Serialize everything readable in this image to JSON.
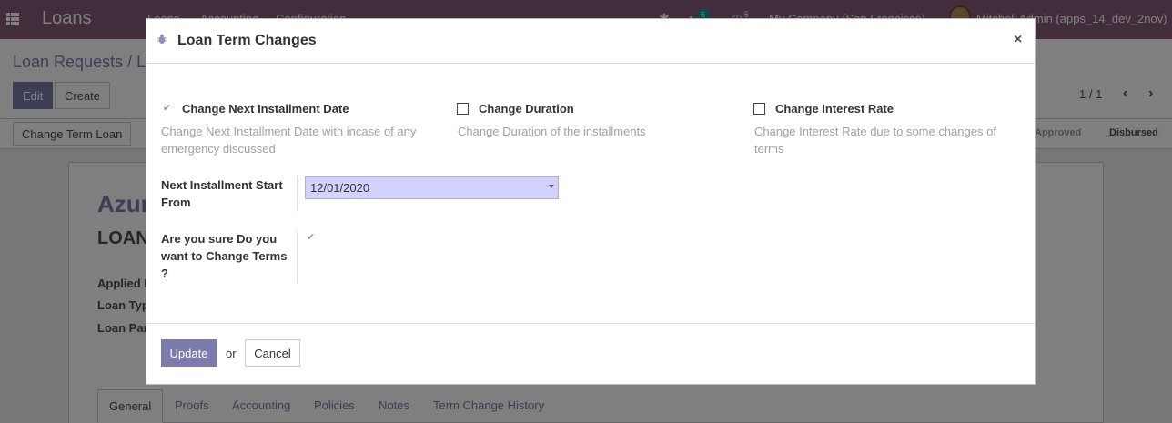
{
  "navbar": {
    "brand": "Loans",
    "menu": [
      "Loans",
      "Accounting",
      "Configuration"
    ],
    "chat_count": "6",
    "activity_count": "5",
    "company": "My Company (San Francisco)",
    "user": "Mitchell Admin (apps_14_dev_2nov)"
  },
  "control_panel": {
    "breadcrumb": "Loan Requests / L",
    "edit_label": "Edit",
    "create_label": "Create",
    "pager": "1 / 1"
  },
  "statusbar": {
    "change_term_label": "Change Term Loan",
    "stages": [
      "Approved",
      "Disbursed"
    ]
  },
  "sheet": {
    "title": "Azur",
    "subtitle": "LOAN",
    "labels": [
      "Applied I",
      "Loan Typ",
      "Loan Par"
    ]
  },
  "tabs": [
    "General",
    "Proofs",
    "Accounting",
    "Policies",
    "Notes",
    "Term Change History"
  ],
  "modal": {
    "title": "Loan Term Changes",
    "options": [
      {
        "label": "Change Next Installment Date",
        "help": "Change Next Installment Date with incase of any emergency discussed",
        "checked": true
      },
      {
        "label": "Change Duration",
        "help": "Change Duration of the installments",
        "checked": false
      },
      {
        "label": "Change Interest Rate",
        "help": "Change Interest Rate due to some changes of terms",
        "checked": false
      }
    ],
    "next_installment": {
      "label": "Next Installment Start From",
      "value": "12/01/2020"
    },
    "confirm": {
      "label": "Are you sure Do you want to Change Terms ?",
      "checked": true
    },
    "footer": {
      "update_label": "Update",
      "or_label": "or",
      "cancel_label": "Cancel"
    }
  },
  "colors": {
    "brand": "#875a7b",
    "primary": "#7c7bad",
    "date_field_bg": "#d2d2ff"
  }
}
